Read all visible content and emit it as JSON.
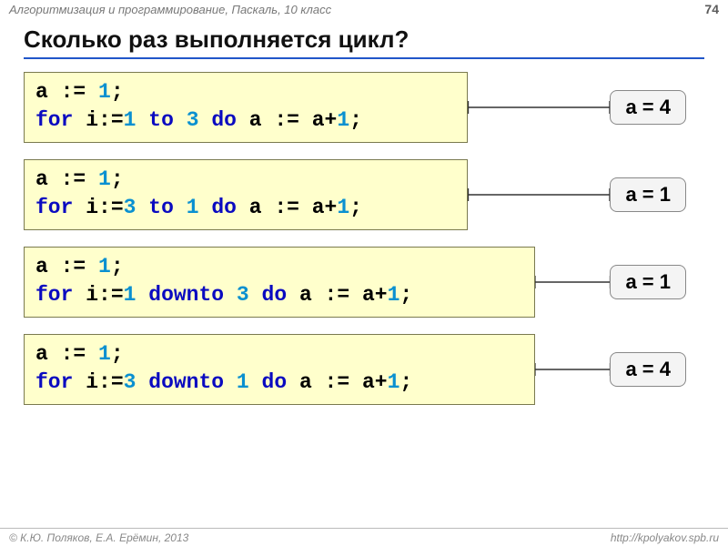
{
  "header": {
    "subject": "Алгоритмизация и программирование, Паскаль, 10 класс",
    "page": "74"
  },
  "title": "Сколько раз выполняется цикл?",
  "blocks": [
    {
      "line1": {
        "p1": "a := ",
        "n1": "1",
        "p2": ";"
      },
      "line2": {
        "p1": "for",
        "p2": " i:=",
        "n1": "1",
        "p3": " ",
        "kw2": "to",
        "p4": " ",
        "n2": "3",
        "p5": " ",
        "kw3": "do",
        "p6": " a := a+",
        "n3": "1",
        "p7": ";"
      },
      "widthClass": "w1",
      "answer": "a = 4"
    },
    {
      "line1": {
        "p1": "a := ",
        "n1": "1",
        "p2": ";"
      },
      "line2": {
        "p1": "for",
        "p2": " i:=",
        "n1": "3",
        "p3": " ",
        "kw2": "to",
        "p4": " ",
        "n2": "1",
        "p5": " ",
        "kw3": "do",
        "p6": " a := a+",
        "n3": "1",
        "p7": ";"
      },
      "widthClass": "w2",
      "answer": "a = 1"
    },
    {
      "line1": {
        "p1": "a := ",
        "n1": "1",
        "p2": ";"
      },
      "line2": {
        "p1": "for",
        "p2": " i:=",
        "n1": "1",
        "p3": " ",
        "kw2": "downto",
        "p4": " ",
        "n2": "3",
        "p5": " ",
        "kw3": "do",
        "p6": " a := a+",
        "n3": "1",
        "p7": ";"
      },
      "widthClass": "w3",
      "answer": "a = 1"
    },
    {
      "line1": {
        "p1": "a := ",
        "n1": "1",
        "p2": ";"
      },
      "line2": {
        "p1": "for",
        "p2": " i:=",
        "n1": "3",
        "p3": " ",
        "kw2": "downto",
        "p4": " ",
        "n2": "1",
        "p5": " ",
        "kw3": "do",
        "p6": " a := a+",
        "n3": "1",
        "p7": ";"
      },
      "widthClass": "w4",
      "answer": "a = 4"
    }
  ],
  "footer": {
    "authors": "© К.Ю. Поляков, Е.А. Ерёмин, 2013",
    "url": "http://kpolyakov.spb.ru"
  }
}
